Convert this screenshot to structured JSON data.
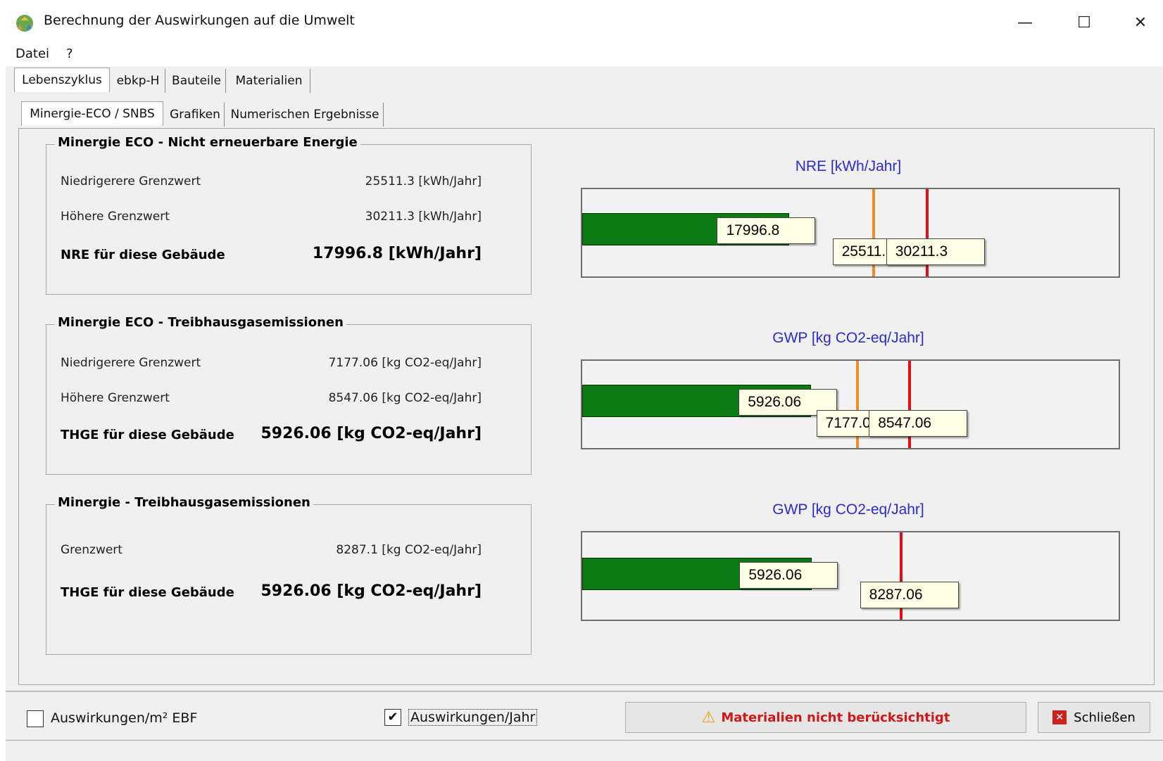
{
  "window": {
    "title": "Berechnung der Auswirkungen auf die Umwelt",
    "minimize": "—",
    "maximize": "☐",
    "close": "✕"
  },
  "menu": [
    "Datei",
    "?"
  ],
  "tabs_outer": [
    "Lebenszyklus",
    "ebkp-H",
    "Bauteile",
    "Materialien"
  ],
  "tabs_inner": [
    "Minergie-ECO / SNBS",
    "Grafiken",
    "Numerischen Ergebnisse"
  ],
  "groups": {
    "nre": {
      "title": "Minergie ECO - Nicht erneuerbare Energie",
      "low_label": "Niedrigerere Grenzwert",
      "low_value": "25511.3 [kWh/Jahr]",
      "high_label": "Höhere Grenzwert",
      "high_value": "30211.3 [kWh/Jahr]",
      "result_label": "NRE für diese Gebäude",
      "result_value": "17996.8 [kWh/Jahr]"
    },
    "thge_eco": {
      "title": "Minergie ECO - Treibhausgasemissionen",
      "low_label": "Niedrigerere Grenzwert",
      "low_value": "7177.06 [kg CO2-eq/Jahr]",
      "high_label": "Höhere Grenzwert",
      "high_value": "8547.06 [kg CO2-eq/Jahr]",
      "result_label": "THGE für diese Gebäude",
      "result_value": "5926.06 [kg CO2-eq/Jahr]"
    },
    "thge_min": {
      "title": "Minergie - Treibhausgasemissionen",
      "limit_label": "Grenzwert",
      "limit_value": "8287.1 [kg CO2-eq/Jahr]",
      "result_label": "THGE für diese Gebäude",
      "result_value": "5926.06 [kg CO2-eq/Jahr]"
    }
  },
  "charts": {
    "nre": {
      "title": "NRE [kWh/Jahr]",
      "bar_label": "17996.8",
      "low_label": "25511.3",
      "high_label": "30211.3"
    },
    "gwp1": {
      "title": "GWP [kg CO2-eq/Jahr]",
      "bar_label": "5926.06",
      "low_label": "7177.06",
      "high_label": "8547.06"
    },
    "gwp2": {
      "title": "GWP [kg CO2-eq/Jahr]",
      "bar_label": "5926.06",
      "limit_label": "8287.06"
    }
  },
  "chart_data": [
    {
      "type": "bar",
      "title": "NRE [kWh/Jahr]",
      "values": [
        17996.8
      ],
      "thresholds": [
        25511.3,
        30211.3
      ],
      "threshold_colors": [
        "#f28c28",
        "#e01010"
      ],
      "bar_color": "#0b7a12"
    },
    {
      "type": "bar",
      "title": "GWP [kg CO2-eq/Jahr]",
      "values": [
        5926.06
      ],
      "thresholds": [
        7177.06,
        8547.06
      ],
      "threshold_colors": [
        "#f28c28",
        "#e01010"
      ],
      "bar_color": "#0b7a12"
    },
    {
      "type": "bar",
      "title": "GWP [kg CO2-eq/Jahr]",
      "values": [
        5926.06
      ],
      "thresholds": [
        8287.06
      ],
      "threshold_colors": [
        "#e01010"
      ],
      "bar_color": "#0b7a12"
    }
  ],
  "footer": {
    "cb_m2_label": "Auswirkungen/m² EBF",
    "cb_m2_checked": false,
    "cb_year_label": "Auswirkungen/Jahr",
    "cb_year_checked": true,
    "warning": "Materialien nicht berücksichtigt",
    "close_button": "Schließen",
    "check_mark": "✔",
    "warning_icon": "⚠",
    "close_icon": "✕"
  }
}
